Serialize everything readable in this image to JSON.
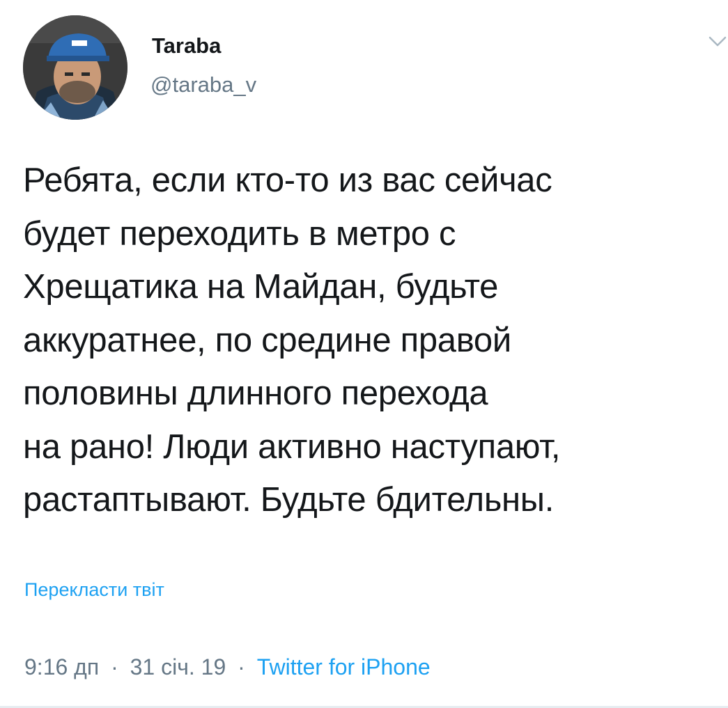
{
  "tweet": {
    "display_name": "Taraba",
    "handle": "@taraba_v",
    "text": "Ребята, если кто-то из вас сейчас\nбудет переходить в метро с\nХрещатика на Майдан, будьте\nаккуратнее, по средине правой\nполовины длинного перехода\nна  рано! Люди активно наступают,\nрастаптывают. Будьте бдительны.",
    "translate_label": "Перекласти твіт",
    "time": "9:16 дп",
    "date": "31 січ. 19",
    "separator": "·",
    "source": "Twitter for iPhone"
  },
  "icons": {
    "menu": "chevron-down-icon",
    "avatar": "profile-photo"
  },
  "colors": {
    "text": "#14171a",
    "secondary": "#657786",
    "link": "#1da1f2",
    "divider": "#e6ecf0"
  }
}
